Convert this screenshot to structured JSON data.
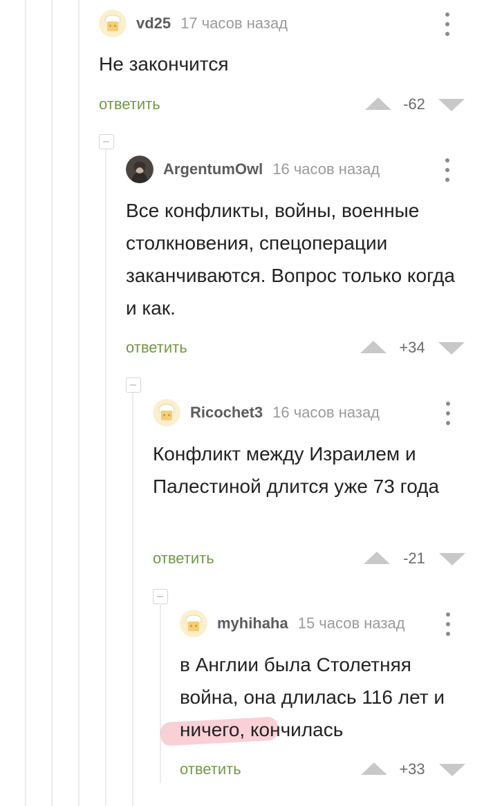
{
  "comments": [
    {
      "username": "vd25",
      "time": "17 часов назад",
      "text": "Не закончится",
      "reply_label": "ответить",
      "rating": "-62",
      "avatar_icon": "chef-hat-avatar-icon"
    },
    {
      "username": "ArgentumOwl",
      "time": "16 часов назад",
      "text": "Все конфликты, войны, военные столкновения, спецоперации заканчиваются. Вопрос только когда и как.",
      "reply_label": "ответить",
      "rating": "+34",
      "avatar_icon": "photo-avatar-icon"
    },
    {
      "username": "Ricochet3",
      "time": "16 часов назад",
      "text": "Конфликт между Израилем и Палестиной длится уже 73 года",
      "reply_label": "ответить",
      "rating": "-21",
      "avatar_icon": "chef-hat-avatar-icon"
    },
    {
      "username": "myhihaha",
      "time": "15 часов назад",
      "text": "в Англии была Столетняя война, она длилась 116 лет и ничего, кончилась",
      "reply_label": "ответить",
      "rating": "+33",
      "avatar_icon": "chef-hat-avatar-icon"
    }
  ],
  "colors": {
    "reply": "#6f9a45",
    "highlight": "#f096a5",
    "thread_line": "#ececec",
    "vote_arrow": "#c8c8c8"
  }
}
